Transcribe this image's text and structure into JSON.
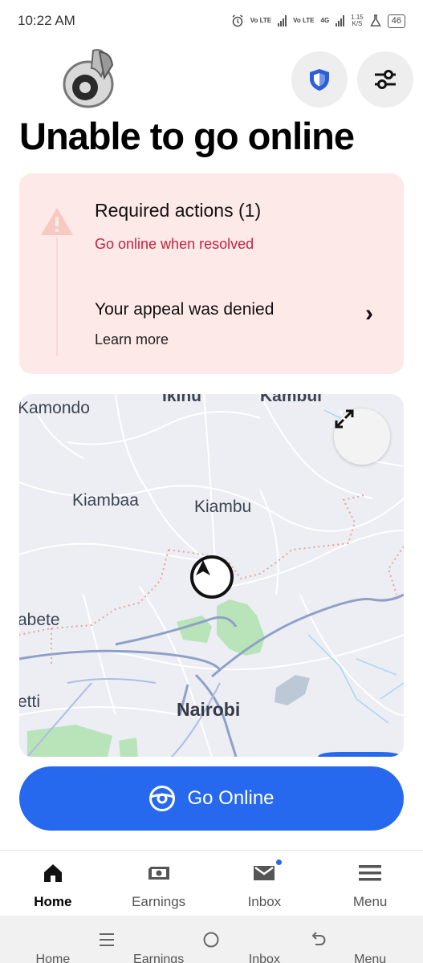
{
  "status_bar": {
    "time": "10:22 AM",
    "network_1": "Vo LTE",
    "network_2": "Vo LTE",
    "network_type": "4G",
    "speed_value": "1.15",
    "speed_unit": "K/S",
    "battery": "46"
  },
  "header": {
    "title": "Unable to go online",
    "shield_icon": "shield-icon",
    "filter_icon": "sliders-icon"
  },
  "alert": {
    "title": "Required actions (1)",
    "subtitle": "Go online when resolved",
    "subtitle_color": "#c4233e",
    "item_title": "Your appeal was denied",
    "item_link": "Learn more",
    "background": "#fde9e7"
  },
  "map": {
    "labels": {
      "ikinu": "Ikinu",
      "kambui": "Kambui",
      "kamondo": "Kamondo",
      "kiambaa": "Kiambaa",
      "kiambu": "Kiambu",
      "abete": "abete",
      "etti": "etti",
      "nairobi": "Nairobi"
    },
    "expand_icon": "expand-arrows-icon",
    "marker_icon": "navigation-arrow-icon"
  },
  "go_online": {
    "label": "Go Online",
    "color": "#2769ee"
  },
  "bottom_nav": {
    "items": [
      {
        "label": "Home",
        "icon": "home-icon"
      },
      {
        "label": "Earnings",
        "icon": "earnings-icon"
      },
      {
        "label": "Inbox",
        "icon": "inbox-icon"
      },
      {
        "label": "Menu",
        "icon": "menu-icon"
      }
    ]
  },
  "system_nav": {
    "ghost": [
      "Home",
      "Earnings",
      "Inbox",
      "Menu"
    ]
  }
}
